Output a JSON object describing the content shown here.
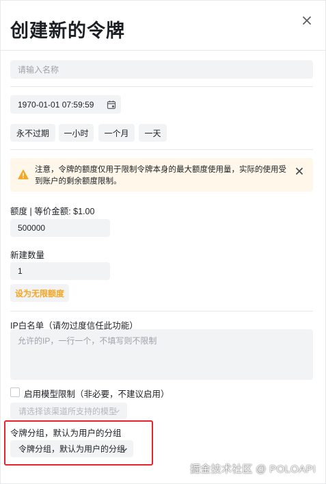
{
  "modal": {
    "title": "创建新的令牌"
  },
  "name_input": {
    "placeholder": "请输入名称"
  },
  "expiry": {
    "date_value": "1970-01-01 07:59:59",
    "quick_buttons": [
      "永不过期",
      "一小时",
      "一个月",
      "一天"
    ]
  },
  "warning": {
    "text": "注意，令牌的额度仅用于限制令牌本身的最大额度使用量，实际的使用受到账户的剩余额度限制。",
    "color": "#f5a623"
  },
  "quota": {
    "label": "额度 | 等价金额: $1.00",
    "value": "500000"
  },
  "count": {
    "label": "新建数量",
    "value": "1"
  },
  "unlimited_button": {
    "label": "设为无限额度"
  },
  "ip_whitelist": {
    "label": "IP白名单（请勿过度信任此功能）",
    "placeholder": "允许的IP，一行一个，不填写则不限制"
  },
  "model_limit": {
    "checkbox_label": "启用模型限制（非必要，不建议启用）",
    "select_placeholder": "请选择该渠道所支持的模型"
  },
  "group": {
    "label": "令牌分组，默认为用户的分组",
    "select_value": "令牌分组，默认为用户的分组",
    "highlight_color": "#e5232b"
  },
  "watermark": {
    "text": "掘金技术社区 @ POLOAPI"
  }
}
